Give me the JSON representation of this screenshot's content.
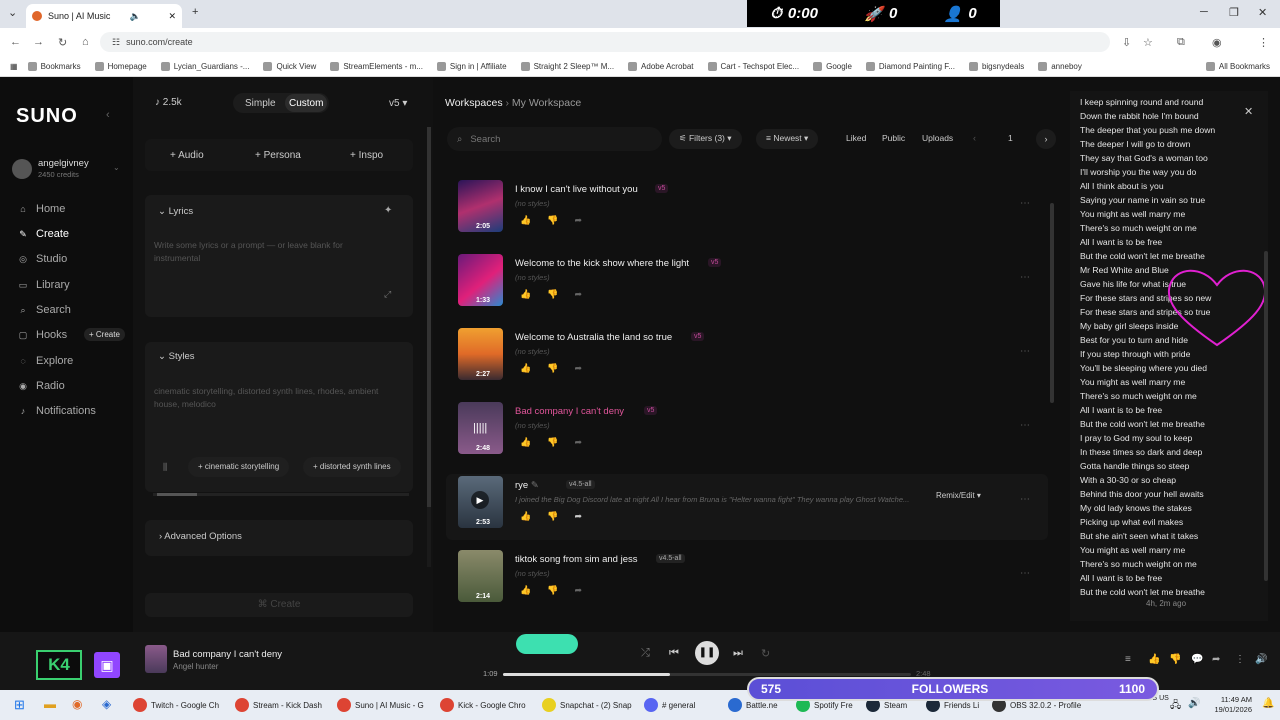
{
  "browser": {
    "tab_title": "Suno | AI Music",
    "url": "suno.com/create",
    "bookmarks": [
      "Bookmarks",
      "Homepage",
      "Lycian_Guardians -...",
      "Quick View",
      "StreamElements - m...",
      "Sign in | Affiliate",
      "Straight 2 Sleep™ M...",
      "Adobe Acrobat",
      "Cart - Techspot Elec...",
      "Google",
      "Diamond Painting F...",
      "bigsnydeals",
      "anneboy",
      "All Bookmarks"
    ]
  },
  "overlay": {
    "timer": "0:00",
    "boosts": "0",
    "viewers": "0"
  },
  "sidebar": {
    "logo": "SUNO",
    "user": {
      "name": "angelgivney",
      "credits": "2450 credits"
    },
    "nav": [
      {
        "label": "Home",
        "icon": "home-icon"
      },
      {
        "label": "Create",
        "icon": "create-icon"
      },
      {
        "label": "Studio",
        "icon": "studio-icon"
      },
      {
        "label": "Library",
        "icon": "library-icon"
      },
      {
        "label": "Search",
        "icon": "search-icon"
      },
      {
        "label": "Hooks",
        "icon": "hooks-icon"
      },
      {
        "label": "Explore",
        "icon": "explore-icon"
      },
      {
        "label": "Radio",
        "icon": "radio-icon"
      },
      {
        "label": "Notifications",
        "icon": "bell-icon"
      }
    ],
    "hooks_create": "+ Create"
  },
  "form": {
    "count": "2.5k",
    "mode_simple": "Simple",
    "mode_custom": "Custom",
    "version": "v5",
    "add_audio": "Audio",
    "add_persona": "Persona",
    "add_inspo": "Inspo",
    "lyrics_label": "Lyrics",
    "lyrics_placeholder": "Write some lyrics or a prompt — or leave blank for instrumental",
    "styles_label": "Styles",
    "styles_value": "cinematic storytelling, distorted synth lines, rhodes, ambient house, melodico",
    "style_chips": [
      "cinematic storytelling",
      "distorted synth lines"
    ],
    "advanced": "Advanced Options",
    "create_button": "Create"
  },
  "workspace": {
    "breadcrumb_root": "Workspaces",
    "breadcrumb_current": "My Workspace",
    "search_placeholder": "Search",
    "filters": "Filters (3)",
    "sort": "Newest",
    "toggles": [
      "Liked",
      "Public",
      "Uploads"
    ],
    "page": "1"
  },
  "songs": [
    {
      "title": "I know I can't live without you",
      "tag": "v5",
      "sub": "(no styles)",
      "duration": "2:05"
    },
    {
      "title": "Welcome to the kick show where the light",
      "tag": "v5",
      "sub": "(no styles)",
      "duration": "1:33"
    },
    {
      "title": "Welcome to Australia the land so true",
      "tag": "v5",
      "sub": "(no styles)",
      "duration": "2:27"
    },
    {
      "title": "Bad company I can't deny",
      "tag": "v5",
      "sub": "(no styles)",
      "duration": "2:48"
    },
    {
      "title": "rye",
      "tag": "v4.5-all",
      "sub": "I joined the Big Dog Discord late at night All I hear from Bruna is \"Helter wanna fight\" They wanna play Ghost Watche...",
      "duration": "2:53"
    },
    {
      "title": "tiktok song from sim and jess",
      "tag": "v4.5-all",
      "sub": "(no styles)",
      "duration": "2:14"
    }
  ],
  "remix_label": "Remix/Edit",
  "lyrics_panel": {
    "lines": [
      "I keep spinning round and round",
      "Down the rabbit hole I'm bound",
      "The deeper that you push me down",
      "The deeper I will go to drown",
      "They say that God's a woman too",
      "I'll worship you the way you do",
      "All I think about is you",
      "Saying your name in vain so true",
      "You might as well marry me",
      "There's so much weight on me",
      "All I want is to be free",
      "But the cold won't let me breathe",
      "Mr Red White and Blue",
      "Gave his life for what is true",
      "For these stars and stripes so new",
      "For these stars and stripes so true",
      "My baby girl sleeps inside",
      "Best for you to turn and hide",
      "If you step through with pride",
      "You'll be sleeping where you died",
      "You might as well marry me",
      "There's so much weight on me",
      "All I want is to be free",
      "But the cold won't let me breathe",
      "I pray to God my soul to keep",
      "In these times so dark and deep",
      "Gotta handle things so steep",
      "With a 30-30 or so cheap",
      "Behind this door your hell awaits",
      "My old lady knows the stakes",
      "Picking up what evil makes",
      "But she ain't seen what it takes",
      "You might as well marry me",
      "There's so much weight on me",
      "All I want is to be free",
      "But the cold won't let me breathe"
    ],
    "timestamp": "4h, 2m ago"
  },
  "player": {
    "title": "Bad company I can't deny",
    "artist": "Angel hunter",
    "elapsed": "1:09",
    "total": "2:48",
    "progress": 0.41
  },
  "followers": {
    "current": "575",
    "label": "FOLLOWERS",
    "goal": "1100"
  },
  "taskbar": {
    "items": [
      "Twitch - Google Ch",
      "Stream - Kick Dash",
      "Suno | AI Music - G",
      "Kick - Google Chro",
      "Snapchat - (2) Snap",
      "# general",
      "Battle.ne",
      "Spotify Fre",
      "Steam",
      "Friends Li",
      "OBS 32.0.2 - Profile"
    ],
    "time": "11:49 AM",
    "date": "19/01/2026",
    "lang": "ENG US"
  },
  "colors": {
    "accent": "#c64b9b",
    "player_green": "#3de0b0",
    "followers_bar": "#5b4fd6"
  }
}
